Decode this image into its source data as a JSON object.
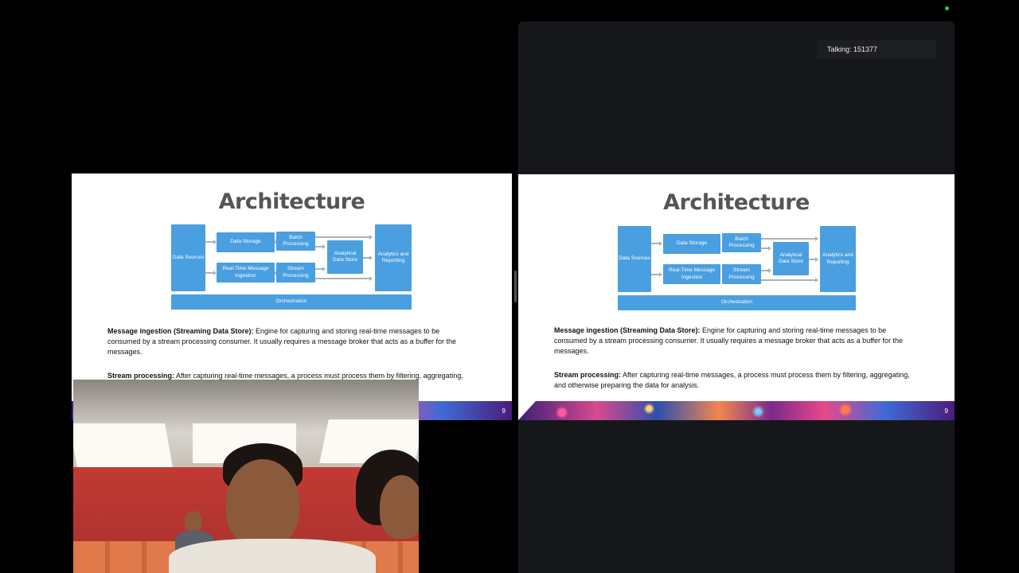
{
  "status": {
    "indicator_color": "#2ecc40"
  },
  "talking_indicator": {
    "text": "Talking: 151377"
  },
  "slide": {
    "title": "Architecture",
    "page_number": "9",
    "diagram": {
      "data_sources": "Data Sources",
      "data_storage": "Data Storage",
      "batch_processing": "Batch Processing",
      "realtime_ingestion": "Real-Time Message Ingestion",
      "stream_processing": "Stream Processing",
      "analytical_store": "Analytical Data Store",
      "analytics_reporting": "Analytics and Reporting",
      "orchestration": "Orchestration"
    },
    "paragraph1": {
      "heading": "Message ingestion (Streaming Data Store):",
      "body": " Engine for capturing and storing real-time messages to be consumed by a stream processing consumer. It usually requires a message broker that acts as a buffer for the messages."
    },
    "paragraph2": {
      "heading": "Stream processing:",
      "body": " After capturing real-time messages, a process must process them by filtering, aggregating, and otherwise preparing the data for analysis."
    }
  },
  "colors": {
    "diagram_blue": "#4a9fe0",
    "panel_bg": "#16171a"
  }
}
